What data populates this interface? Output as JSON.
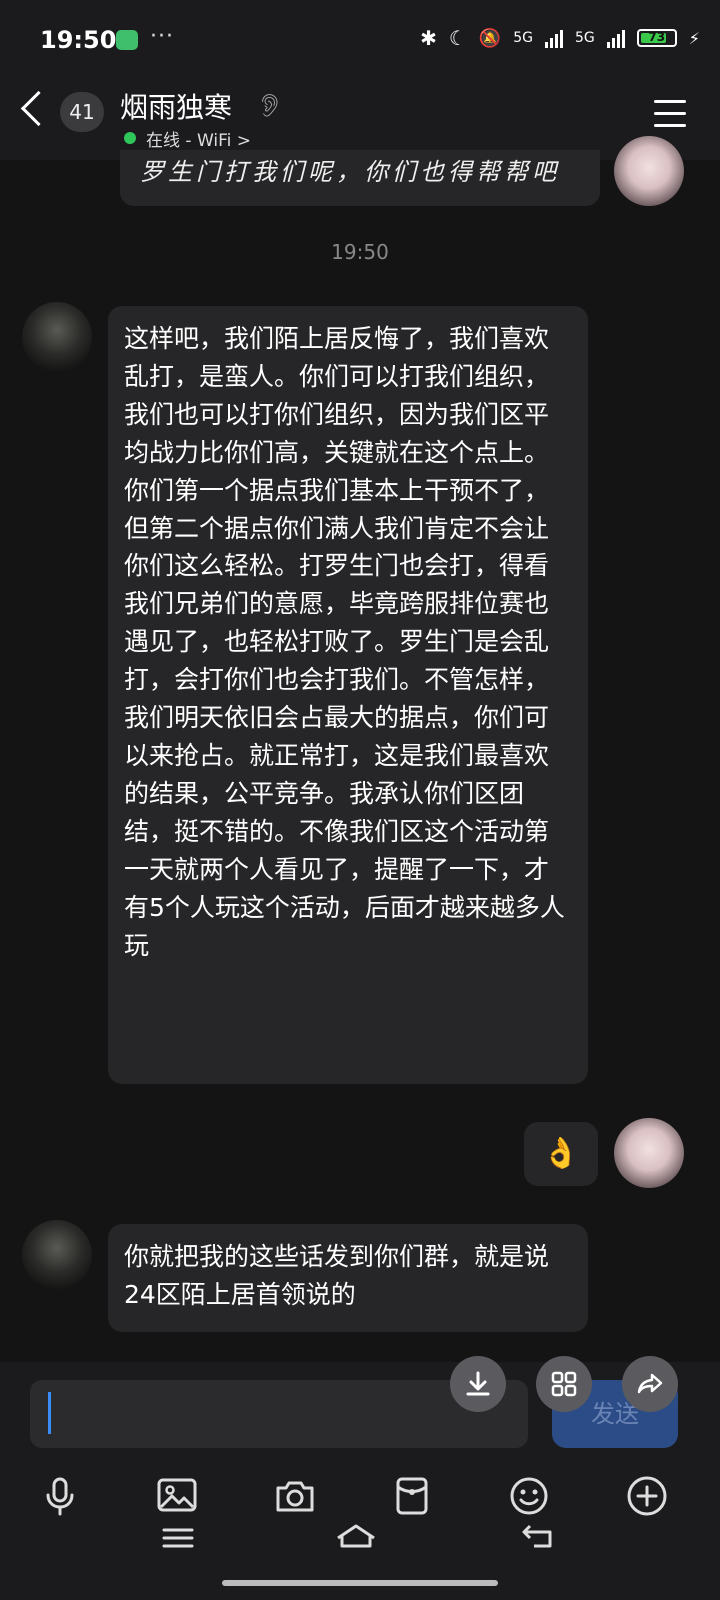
{
  "status_bar": {
    "time": "19:50",
    "more": "···",
    "signal1": "5G",
    "signal2": "5G",
    "battery": "73"
  },
  "header": {
    "unread_count": "41",
    "contact_name": "烟雨独寒",
    "status_text": "在线 - WiFi >"
  },
  "messages": {
    "partial_top": "罗生门打我们呢，你们也得帮帮吧",
    "time_label": "19:50",
    "long_message": "这样吧，我们陌上居反悔了，我们喜欢乱打，是蛮人。你们可以打我们组织，我们也可以打你们组织，因为我们区平均战力比你们高，关键就在这个点上。你们第一个据点我们基本上干预不了，但第二个据点你们满人我们肯定不会让你们这么轻松。打罗生门也会打，得看我们兄弟们的意愿，毕竟跨服排位赛也遇见了，也轻松打败了。罗生门是会乱打，会打你们也会打我们。不管怎样，我们明天依旧会占最大的据点，你们可以来抢占。就正常打，这是我们最喜欢的结果，公平竞争。我承认你们区团结，挺不错的。不像我们区这个活动第一天就两个人看见了，提醒了一下，才有5个人玩这个活动，后面才越来越多人玩",
    "emoji_reply": "👌",
    "last_message": "你就把我的这些话发到你们群，就是说24区陌上居首领说的"
  },
  "input": {
    "value": "",
    "send_label": "发送"
  },
  "colors": {
    "online": "#2fc65a",
    "bubble": "#262628",
    "send_button": "#2b4c86"
  }
}
